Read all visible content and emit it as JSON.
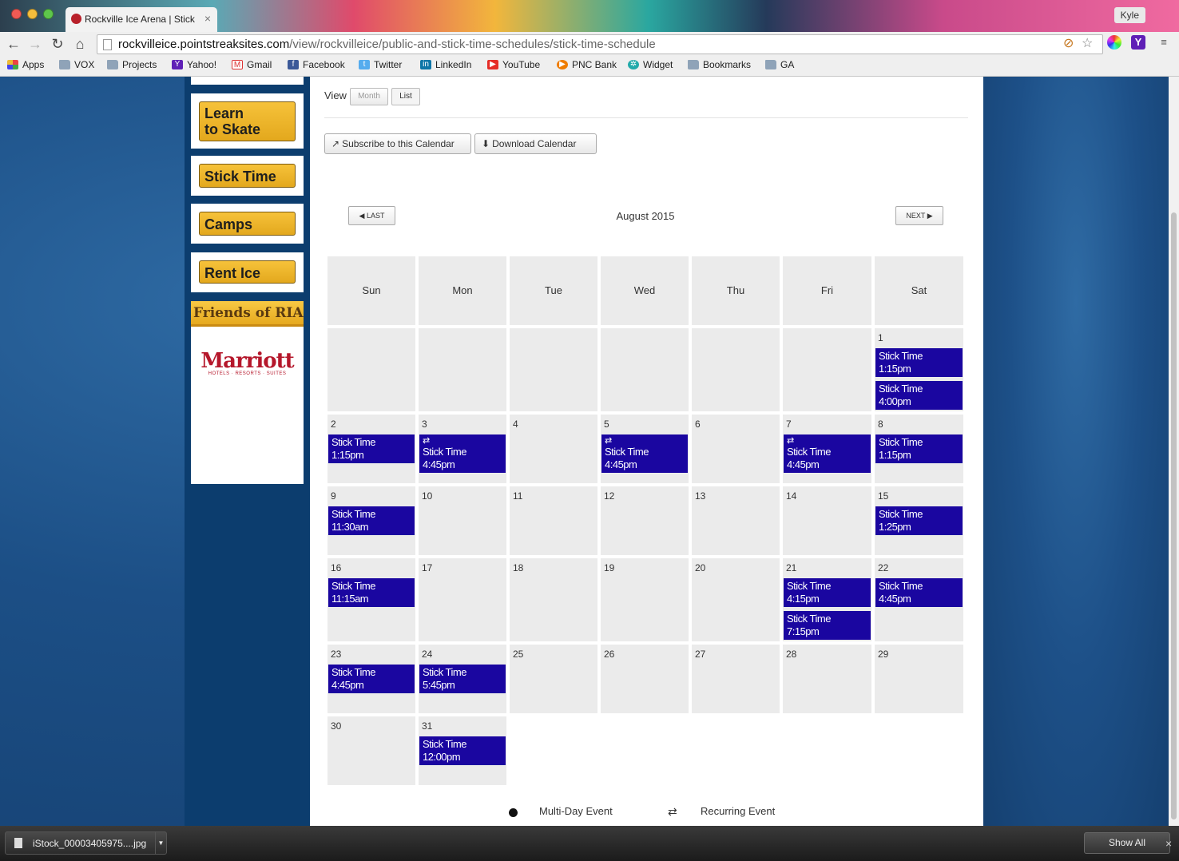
{
  "browser": {
    "tab_title": "Rockville Ice Arena | Stick",
    "user_badge": "Kyle",
    "url_domain": "rockvilleice.pointstreaksites.com",
    "url_path": "/view/rockvilleice/public-and-stick-time-schedules/stick-time-schedule",
    "bookmarks": [
      {
        "label": "Apps",
        "icon": "apps-grid-icon"
      },
      {
        "label": "VOX",
        "icon": "folder-icon"
      },
      {
        "label": "Projects",
        "icon": "folder-icon"
      },
      {
        "label": "Yahoo!",
        "icon": "yahoo-icon"
      },
      {
        "label": "Gmail",
        "icon": "gmail-icon"
      },
      {
        "label": "Facebook",
        "icon": "facebook-icon"
      },
      {
        "label": "Twitter",
        "icon": "twitter-icon"
      },
      {
        "label": "LinkedIn",
        "icon": "linkedin-icon"
      },
      {
        "label": "YouTube",
        "icon": "youtube-icon"
      },
      {
        "label": "PNC Bank",
        "icon": "pnc-icon"
      },
      {
        "label": "Widget",
        "icon": "widget-icon"
      },
      {
        "label": "Bookmarks",
        "icon": "folder-icon"
      },
      {
        "label": "GA",
        "icon": "folder-icon"
      }
    ],
    "download_file": "iStock_00003405975....jpg",
    "show_all": "Show All"
  },
  "sidebar": {
    "buttons": [
      {
        "line1": "Learn",
        "line2": "to Skate"
      },
      {
        "line1": "Stick Time"
      },
      {
        "line1": "Camps"
      },
      {
        "line1": "Rent Ice"
      }
    ],
    "friends_heading": "Friends of RIA",
    "sponsor_name": "Marriott",
    "sponsor_tagline": "HOTELS · RESORTS · SUITES"
  },
  "calendar": {
    "view_label": "View",
    "view_month": "Month",
    "view_list": "List",
    "subscribe": "Subscribe to this Calendar",
    "download": "Download Calendar",
    "last": "LAST",
    "next": "NEXT",
    "month_title": "August 2015",
    "weekdays": [
      "Sun",
      "Mon",
      "Tue",
      "Wed",
      "Thu",
      "Fri",
      "Sat"
    ],
    "weeks": [
      [
        null,
        null,
        null,
        null,
        null,
        null,
        {
          "day": "1",
          "events": [
            {
              "title": "Stick Time",
              "time": "1:15pm"
            },
            {
              "title": "Stick Time",
              "time": "4:00pm"
            }
          ]
        }
      ],
      [
        {
          "day": "2",
          "events": [
            {
              "title": "Stick Time",
              "time": "1:15pm"
            }
          ]
        },
        {
          "day": "3",
          "events": [
            {
              "title": "Stick Time",
              "time": "4:45pm",
              "recurring": true
            }
          ]
        },
        {
          "day": "4",
          "events": []
        },
        {
          "day": "5",
          "events": [
            {
              "title": "Stick Time",
              "time": "4:45pm",
              "recurring": true
            }
          ]
        },
        {
          "day": "6",
          "events": []
        },
        {
          "day": "7",
          "events": [
            {
              "title": "Stick Time",
              "time": "4:45pm",
              "recurring": true
            }
          ]
        },
        {
          "day": "8",
          "events": [
            {
              "title": "Stick Time",
              "time": "1:15pm"
            }
          ]
        }
      ],
      [
        {
          "day": "9",
          "events": [
            {
              "title": "Stick Time",
              "time": "11:30am"
            }
          ]
        },
        {
          "day": "10",
          "events": []
        },
        {
          "day": "11",
          "events": []
        },
        {
          "day": "12",
          "events": []
        },
        {
          "day": "13",
          "events": []
        },
        {
          "day": "14",
          "events": []
        },
        {
          "day": "15",
          "events": [
            {
              "title": "Stick Time",
              "time": "1:25pm"
            }
          ]
        }
      ],
      [
        {
          "day": "16",
          "events": [
            {
              "title": "Stick Time",
              "time": "11:15am"
            }
          ]
        },
        {
          "day": "17",
          "events": []
        },
        {
          "day": "18",
          "events": []
        },
        {
          "day": "19",
          "events": []
        },
        {
          "day": "20",
          "events": []
        },
        {
          "day": "21",
          "events": [
            {
              "title": "Stick Time",
              "time": "4:15pm"
            },
            {
              "title": "Stick Time",
              "time": "7:15pm"
            }
          ]
        },
        {
          "day": "22",
          "events": [
            {
              "title": "Stick Time",
              "time": "4:45pm"
            }
          ]
        }
      ],
      [
        {
          "day": "23",
          "events": [
            {
              "title": "Stick Time",
              "time": "4:45pm"
            }
          ]
        },
        {
          "day": "24",
          "events": [
            {
              "title": "Stick Time",
              "time": "5:45pm"
            }
          ]
        },
        {
          "day": "25",
          "events": []
        },
        {
          "day": "26",
          "events": []
        },
        {
          "day": "27",
          "events": []
        },
        {
          "day": "28",
          "events": []
        },
        {
          "day": "29",
          "events": []
        }
      ],
      [
        {
          "day": "30",
          "events": []
        },
        {
          "day": "31",
          "events": [
            {
              "title": "Stick Time",
              "time": "12:00pm"
            }
          ]
        },
        null,
        null,
        null,
        null,
        null
      ]
    ],
    "legend_multiday": "Multi-Day Event",
    "legend_recurring": "Recurring Event"
  },
  "colors": {
    "event_bg": "#1a06a0",
    "sidebar_bg": "#0c3d6e",
    "button_gold": "#f0b72f"
  }
}
